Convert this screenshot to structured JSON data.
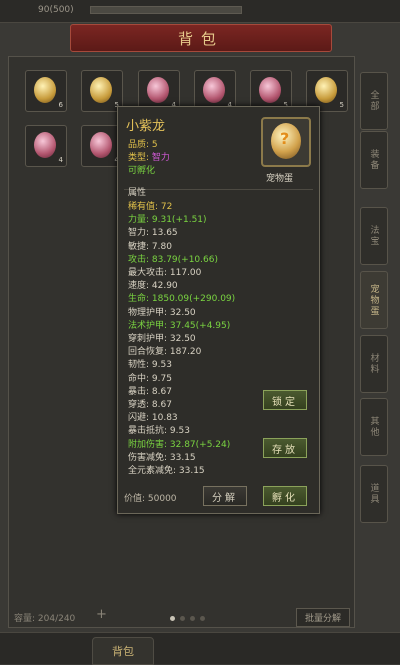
{
  "topbar": {
    "gold": "90(500)"
  },
  "header": {
    "title": "背包"
  },
  "slots": [
    {
      "count": "6",
      "type": "gold"
    },
    {
      "count": "5",
      "type": "gold"
    },
    {
      "count": "4",
      "type": "pink"
    },
    {
      "count": "4",
      "type": "pink"
    },
    {
      "count": "5",
      "type": "pink"
    },
    {
      "count": "5",
      "type": "gold"
    },
    {
      "count": "4",
      "type": "pink"
    },
    {
      "count": "4",
      "type": "pink"
    }
  ],
  "sidetabs": [
    "全部",
    "装备",
    "法宝",
    "宠物蛋",
    "材料",
    "其他",
    "道具"
  ],
  "footer": {
    "capacity": "容量: 204/240",
    "plus": "+",
    "batch": "批量分解"
  },
  "bottomnav": {
    "bag": "背包"
  },
  "tooltip": {
    "name": "小紫龙",
    "quality": "品质: 5",
    "type_label": "类型: ",
    "type_value": "智力",
    "hatchable": "可孵化",
    "icon_label": "宠物蛋",
    "attr_header": "属性",
    "attrs": [
      {
        "text": "稀有值: 72",
        "color": "gold"
      },
      {
        "text": "力量: 9.31(+1.51)",
        "color": "green"
      },
      {
        "text": "智力: 13.65",
        "color": "white"
      },
      {
        "text": "敏捷: 7.80",
        "color": "white"
      },
      {
        "text": "攻击: 83.79(+10.66)",
        "color": "green"
      },
      {
        "text": "最大攻击: 117.00",
        "color": "white"
      },
      {
        "text": "速度: 42.90",
        "color": "white"
      },
      {
        "text": "生命: 1850.09(+290.09)",
        "color": "green"
      },
      {
        "text": "物理护甲: 32.50",
        "color": "white"
      },
      {
        "text": "法术护甲: 37.45(+4.95)",
        "color": "green"
      },
      {
        "text": "穿刺护甲: 32.50",
        "color": "white"
      },
      {
        "text": "回合恢复: 187.20",
        "color": "white"
      },
      {
        "text": "韧性: 9.53",
        "color": "white"
      },
      {
        "text": "命中: 9.75",
        "color": "white"
      },
      {
        "text": "暴击: 8.67",
        "color": "white"
      },
      {
        "text": "穿透: 8.67",
        "color": "white"
      },
      {
        "text": "闪避: 10.83",
        "color": "white"
      },
      {
        "text": "暴击抵抗: 9.53",
        "color": "white"
      },
      {
        "text": "附加伤害: 32.87(+5.24)",
        "color": "green"
      },
      {
        "text": "伤害减免: 33.15",
        "color": "white"
      },
      {
        "text": "全元素减免: 33.15",
        "color": "white"
      }
    ],
    "value_label": "价值: 50000",
    "btn_lock": "锁定",
    "btn_store": "存放",
    "btn_decompose": "分解",
    "btn_hatch": "孵化"
  }
}
